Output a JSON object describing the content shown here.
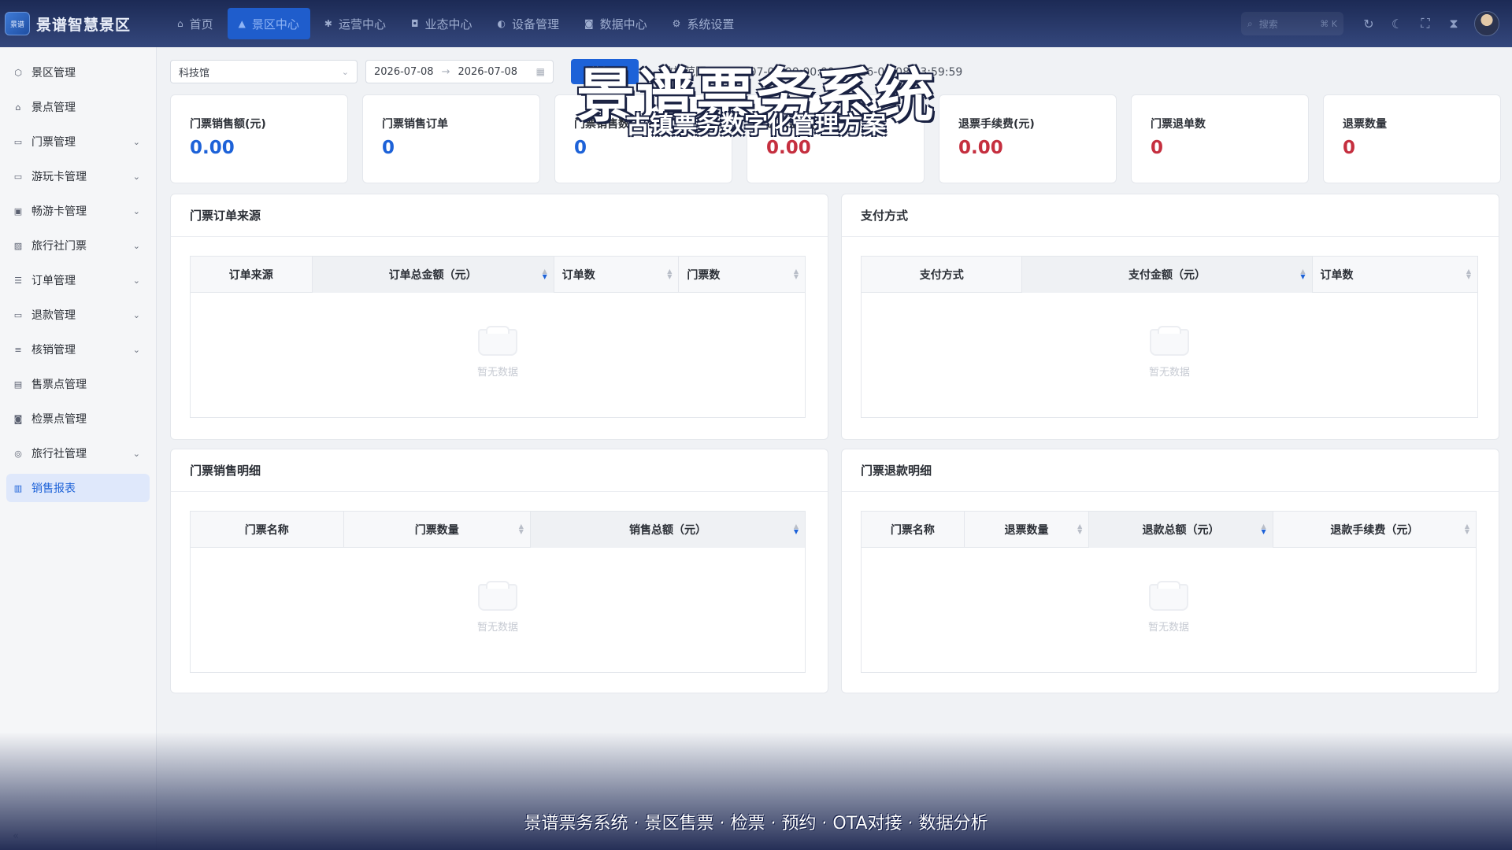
{
  "brand": {
    "name": "景谱智慧景区",
    "logo_text": "景谱"
  },
  "topnav": [
    {
      "label": "首页",
      "icon": "home-icon",
      "glyph": "⌂",
      "active": false
    },
    {
      "label": "景区中心",
      "icon": "image-icon",
      "glyph": "▲",
      "active": true
    },
    {
      "label": "运营中心",
      "icon": "sparkle-icon",
      "glyph": "✱",
      "active": false
    },
    {
      "label": "业态中心",
      "icon": "box-icon",
      "glyph": "◘",
      "active": false
    },
    {
      "label": "设备管理",
      "icon": "device-icon",
      "glyph": "◐",
      "active": false
    },
    {
      "label": "数据中心",
      "icon": "chart-icon",
      "glyph": "◙",
      "active": false
    },
    {
      "label": "系统设置",
      "icon": "gear-icon",
      "glyph": "⚙",
      "active": false
    }
  ],
  "search": {
    "placeholder": "搜索",
    "shortcut": "⌘ K"
  },
  "sidebar": {
    "items": [
      {
        "label": "景区管理",
        "icon": "scenic-icon",
        "glyph": "⬡",
        "expandable": false,
        "active": false
      },
      {
        "label": "景点管理",
        "icon": "spot-icon",
        "glyph": "⌂",
        "expandable": false,
        "active": false
      },
      {
        "label": "门票管理",
        "icon": "ticket-icon",
        "glyph": "▭",
        "expandable": true,
        "active": false
      },
      {
        "label": "游玩卡管理",
        "icon": "card-icon",
        "glyph": "▭",
        "expandable": true,
        "active": false
      },
      {
        "label": "畅游卡管理",
        "icon": "pass-icon",
        "glyph": "▣",
        "expandable": true,
        "active": false
      },
      {
        "label": "旅行社门票",
        "icon": "agency-ticket-icon",
        "glyph": "▨",
        "expandable": true,
        "active": false
      },
      {
        "label": "订单管理",
        "icon": "order-icon",
        "glyph": "☰",
        "expandable": true,
        "active": false
      },
      {
        "label": "退款管理",
        "icon": "refund-icon",
        "glyph": "▭",
        "expandable": true,
        "active": false
      },
      {
        "label": "核销管理",
        "icon": "verify-icon",
        "glyph": "≡",
        "expandable": true,
        "active": false
      },
      {
        "label": "售票点管理",
        "icon": "sale-point-icon",
        "glyph": "▤",
        "expandable": false,
        "active": false
      },
      {
        "label": "检票点管理",
        "icon": "check-point-icon",
        "glyph": "◙",
        "expandable": false,
        "active": false
      },
      {
        "label": "旅行社管理",
        "icon": "agency-icon",
        "glyph": "◎",
        "expandable": true,
        "active": false
      },
      {
        "label": "销售报表",
        "icon": "report-icon",
        "glyph": "▥",
        "expandable": false,
        "active": true
      }
    ],
    "collapse_label": "«"
  },
  "filters": {
    "scenic_select": "科技馆",
    "date_start": "2026-07-08",
    "date_end": "2026-07-08",
    "refresh_label": "刷新",
    "range_text": "数据范围：2026-07-08 00:00:00 - 2026-07-08 23:59:59"
  },
  "stats": [
    {
      "label": "门票销售额(元)",
      "value": "0.00",
      "tone": "blue"
    },
    {
      "label": "门票销售订单",
      "value": "0",
      "tone": "blue"
    },
    {
      "label": "门票销售数",
      "value": "0",
      "tone": "blue"
    },
    {
      "label": "退款金额(元)",
      "value": "0.00",
      "tone": "red"
    },
    {
      "label": "退票手续费(元)",
      "value": "0.00",
      "tone": "red"
    },
    {
      "label": "门票退单数",
      "value": "0",
      "tone": "red"
    },
    {
      "label": "退票数量",
      "value": "0",
      "tone": "red"
    }
  ],
  "panels": {
    "order_source": {
      "title": "门票订单来源",
      "columns": [
        "订单来源",
        "订单总金额（元）",
        "订单数",
        "门票数"
      ],
      "empty_text": "暂无数据"
    },
    "payment": {
      "title": "支付方式",
      "columns": [
        "支付方式",
        "支付金额（元）",
        "订单数"
      ],
      "empty_text": "暂无数据"
    },
    "sales_detail": {
      "title": "门票销售明细",
      "columns": [
        "门票名称",
        "门票数量",
        "销售总额（元）"
      ],
      "empty_text": "暂无数据"
    },
    "refund_detail": {
      "title": "门票退款明细",
      "columns": [
        "门票名称",
        "退票数量",
        "退款总额（元）",
        "退款手续费（元）"
      ],
      "empty_text": "暂无数据"
    }
  },
  "overlay": {
    "title": "景谱票务系统",
    "subtitle": "古镇票务数字化管理方案",
    "caption": "景谱票务系统 · 景区售票 · 检票 · 预约 · OTA对接 · 数据分析"
  },
  "colors": {
    "accent": "#1d62d8",
    "danger": "#c52f3f",
    "header_bg": "#1c2a55"
  }
}
